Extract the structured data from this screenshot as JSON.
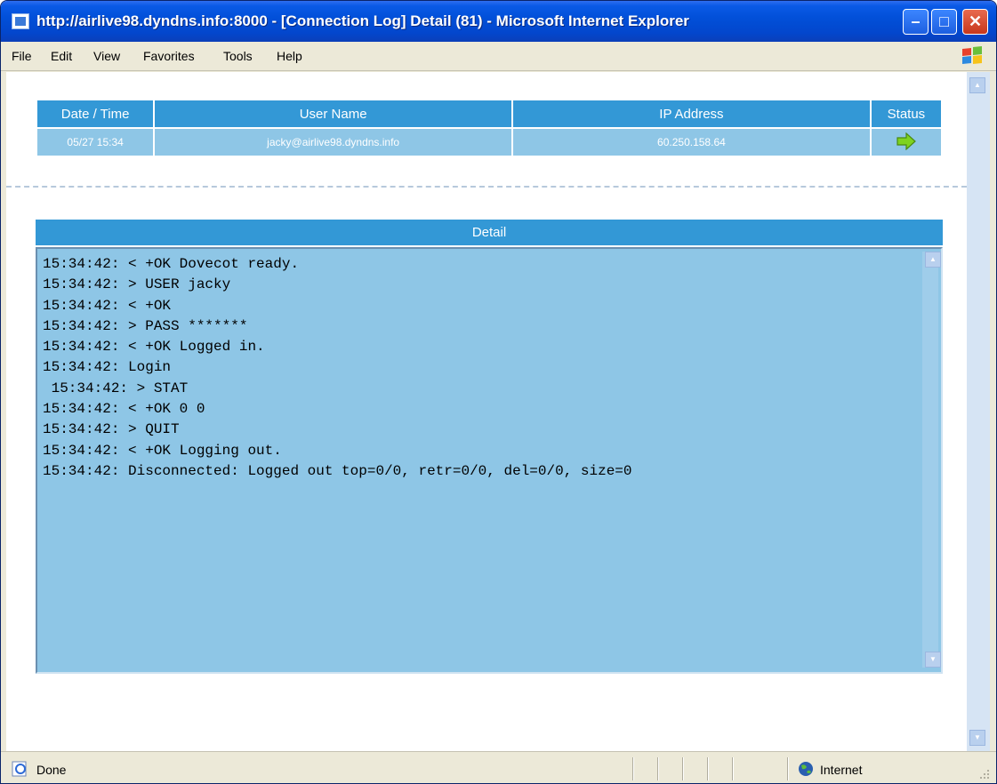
{
  "window": {
    "title": "http://airlive98.dyndns.info:8000 - [Connection Log] Detail (81) - Microsoft Internet Explorer",
    "controls": {
      "minimize": "–",
      "maximize": "□",
      "close": "✕"
    }
  },
  "menu": [
    "File",
    "Edit",
    "View",
    "Favorites",
    "Tools",
    "Help"
  ],
  "connection": {
    "headers": {
      "datetime": "Date / Time",
      "user": "User Name",
      "ip": "IP Address",
      "status": "Status"
    },
    "row": {
      "datetime": "05/27 15:34",
      "user": "jacky@airlive98.dyndns.info",
      "ip": "60.250.158.64",
      "status_icon": "arrow-right-icon"
    }
  },
  "detail": {
    "header": "Detail",
    "lines": [
      "15:34:42: < +OK Dovecot ready.",
      "15:34:42: > USER jacky",
      "15:34:42: < +OK",
      "15:34:42: > PASS *******",
      "15:34:42: < +OK Logged in.",
      "15:34:42: Login",
      " 15:34:42: > STAT",
      "15:34:42: < +OK 0 0",
      "15:34:42: > QUIT",
      "15:34:42: < +OK Logging out.",
      "15:34:42: Disconnected: Logged out top=0/0, retr=0/0, del=0/0, size=0"
    ]
  },
  "statusbar": {
    "text": "Done",
    "zone": "Internet"
  },
  "colors": {
    "header": "#3398d6",
    "cell": "#8ec6e6",
    "titlebar": "#0250d9",
    "status_arrow": "#7ed321"
  }
}
